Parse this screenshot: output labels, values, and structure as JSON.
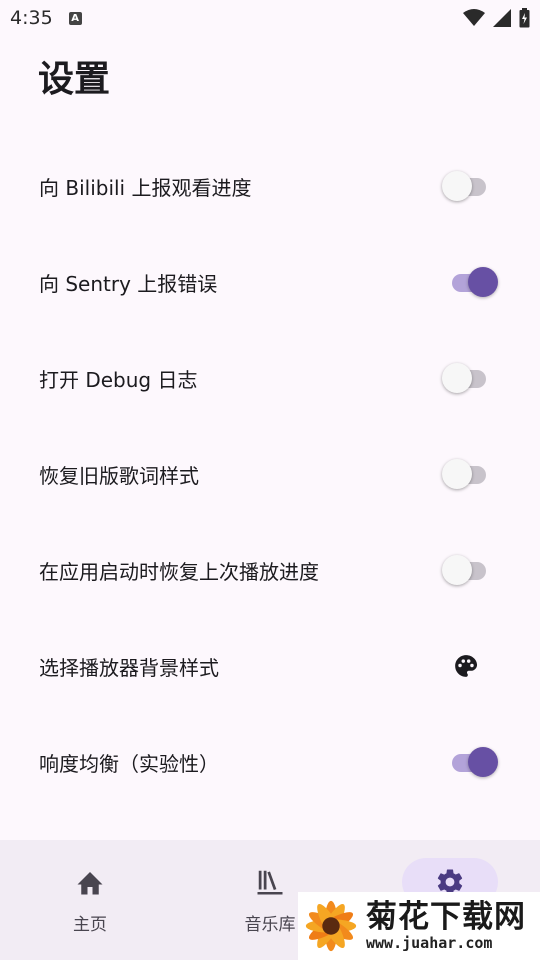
{
  "status_bar": {
    "time": "4:35",
    "notif_letter": "A"
  },
  "page": {
    "title": "设置"
  },
  "settings": [
    {
      "label": "向 Bilibili 上报观看进度",
      "type": "switch",
      "on": false
    },
    {
      "label": "向 Sentry 上报错误",
      "type": "switch",
      "on": true
    },
    {
      "label": "打开 Debug 日志",
      "type": "switch",
      "on": false
    },
    {
      "label": "恢复旧版歌词样式",
      "type": "switch",
      "on": false
    },
    {
      "label": "在应用启动时恢复上次播放进度",
      "type": "switch",
      "on": false
    },
    {
      "label": "选择播放器背景样式",
      "type": "icon",
      "icon": "palette-icon"
    },
    {
      "label": "响度均衡（实验性）",
      "type": "switch",
      "on": true
    }
  ],
  "nav": {
    "items": [
      {
        "label": "主页",
        "icon": "home-icon",
        "selected": false
      },
      {
        "label": "音乐库",
        "icon": "library-icon",
        "selected": false
      },
      {
        "label": "",
        "icon": "settings-gear-icon",
        "selected": true
      }
    ]
  },
  "colors": {
    "accent": "#6750a4",
    "track_on": "#b3a3d9",
    "background": "#fdf8fd",
    "nav_bg": "#f2ecf4",
    "nav_indicator": "#e8def8"
  },
  "watermark": {
    "title": "菊花下载网",
    "url": "www.juahar.com"
  }
}
